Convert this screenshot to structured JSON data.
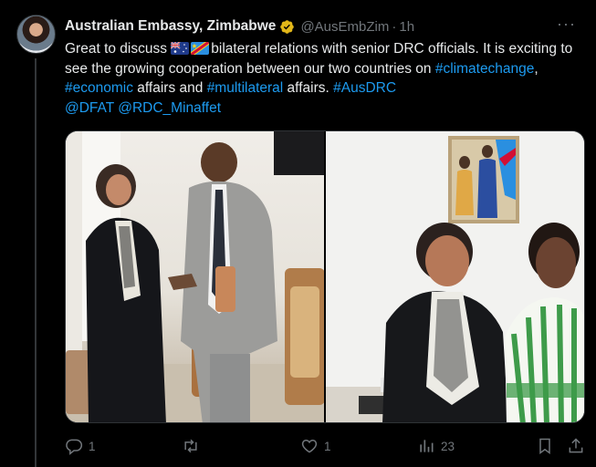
{
  "tweet": {
    "display_name": "Australian Embassy, Zimbabwe",
    "handle": "@AusEmbZim",
    "separator": "·",
    "time": "1h",
    "more_label": "···",
    "text": {
      "part1": "Great to discuss ",
      "part2": "bilateral relations with senior DRC officials. It is exciting to see the growing cooperation between our two countries on ",
      "tag1": "#climatechange",
      "part3": ", ",
      "tag2": "#economic",
      "part4": " affairs and ",
      "tag3": "#multilateral",
      "part5": " affairs. ",
      "tag4": "#AusDRC",
      "mention1": "@DFAT",
      "mention2": "@RDC_Minaffet"
    },
    "flags": [
      "australia-flag-icon",
      "drc-flag-icon"
    ]
  },
  "actions": {
    "replies": "1",
    "retweets": "",
    "likes": "1",
    "views": "23"
  },
  "colors": {
    "background": "#000000",
    "text": "#e7e9ea",
    "muted": "#71767b",
    "link": "#1d9bf0",
    "verified_gold": "#e2b719"
  }
}
